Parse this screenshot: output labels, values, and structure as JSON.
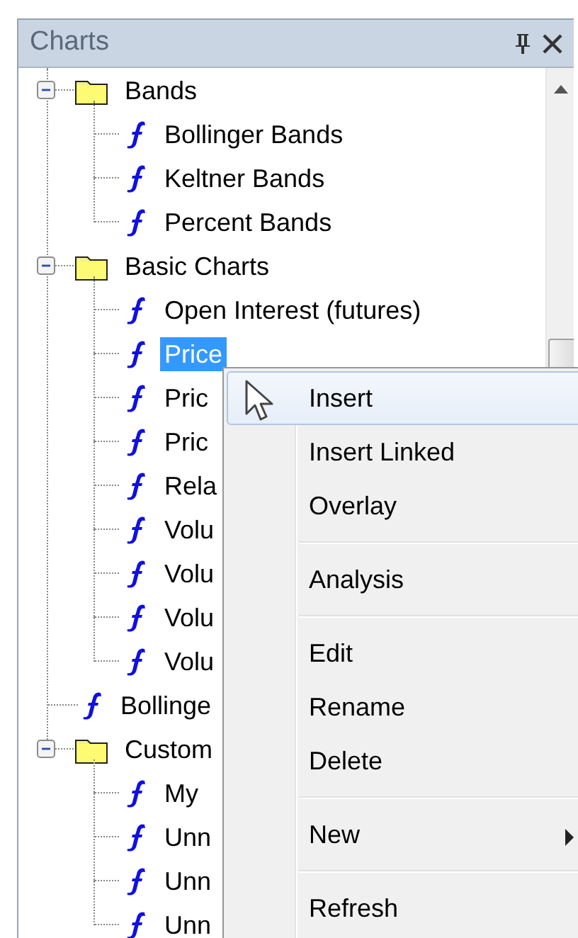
{
  "panel": {
    "title": "Charts"
  },
  "tree": [
    {
      "kind": "folder",
      "label": "Bands",
      "expanded": true,
      "selected": false,
      "children": [
        {
          "kind": "function",
          "label": "Bollinger Bands",
          "selected": false
        },
        {
          "kind": "function",
          "label": "Keltner Bands",
          "selected": false
        },
        {
          "kind": "function",
          "label": "Percent Bands",
          "selected": false
        }
      ]
    },
    {
      "kind": "folder",
      "label": "Basic Charts",
      "expanded": true,
      "selected": false,
      "children": [
        {
          "kind": "function",
          "label": "Open Interest (futures)",
          "selected": false
        },
        {
          "kind": "function",
          "label": "Price",
          "selected": true
        },
        {
          "kind": "function",
          "label": "Pric",
          "selected": false
        },
        {
          "kind": "function",
          "label": "Pric",
          "selected": false
        },
        {
          "kind": "function",
          "label": "Rela",
          "selected": false
        },
        {
          "kind": "function",
          "label": "Volu",
          "selected": false
        },
        {
          "kind": "function",
          "label": "Volu",
          "selected": false
        },
        {
          "kind": "function",
          "label": "Volu",
          "selected": false
        },
        {
          "kind": "function",
          "label": "Volu",
          "selected": false
        }
      ]
    },
    {
      "kind": "function",
      "label": "Bollinge",
      "selected": false
    },
    {
      "kind": "folder",
      "label": "Custom",
      "expanded": true,
      "selected": false,
      "children": [
        {
          "kind": "function",
          "label": "My",
          "selected": false
        },
        {
          "kind": "function",
          "label": "Unn",
          "selected": false
        },
        {
          "kind": "function",
          "label": "Unn",
          "selected": false
        },
        {
          "kind": "function",
          "label": "Unn",
          "selected": false
        }
      ]
    }
  ],
  "context_menu": [
    {
      "kind": "item",
      "label": "Insert",
      "highlighted": true,
      "submenu": false
    },
    {
      "kind": "item",
      "label": "Insert Linked",
      "highlighted": false,
      "submenu": false
    },
    {
      "kind": "item",
      "label": "Overlay",
      "highlighted": false,
      "submenu": false
    },
    {
      "kind": "separator"
    },
    {
      "kind": "item",
      "label": "Analysis",
      "highlighted": false,
      "submenu": false
    },
    {
      "kind": "separator"
    },
    {
      "kind": "item",
      "label": "Edit",
      "highlighted": false,
      "submenu": false
    },
    {
      "kind": "item",
      "label": "Rename",
      "highlighted": false,
      "submenu": false
    },
    {
      "kind": "item",
      "label": "Delete",
      "highlighted": false,
      "submenu": false
    },
    {
      "kind": "separator"
    },
    {
      "kind": "item",
      "label": "New",
      "highlighted": false,
      "submenu": true
    },
    {
      "kind": "separator"
    },
    {
      "kind": "item",
      "label": "Refresh",
      "highlighted": false,
      "submenu": false
    }
  ]
}
